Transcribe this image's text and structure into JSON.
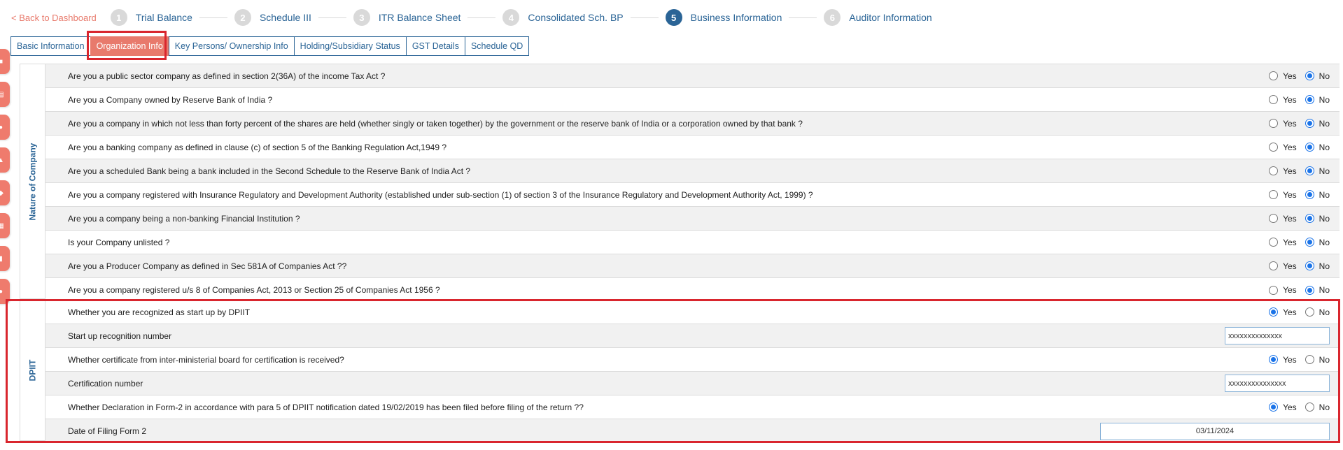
{
  "nav": {
    "back_label": "< Back to Dashboard",
    "steps": [
      {
        "num": "1",
        "label": "Trial Balance"
      },
      {
        "num": "2",
        "label": "Schedule III"
      },
      {
        "num": "3",
        "label": "ITR Balance Sheet"
      },
      {
        "num": "4",
        "label": "Consolidated Sch. BP"
      },
      {
        "num": "5",
        "label": "Business Information"
      },
      {
        "num": "6",
        "label": "Auditor Information"
      }
    ],
    "active_step": "5"
  },
  "tabs": [
    {
      "label": "Basic Information"
    },
    {
      "label": "Organization Info"
    },
    {
      "label": "Key Persons/ Ownership Info"
    },
    {
      "label": "Holding/Subsidiary Status"
    },
    {
      "label": "GST Details"
    },
    {
      "label": "Schedule QD"
    }
  ],
  "active_tab": "Organization Info",
  "radio_labels": {
    "yes": "Yes",
    "no": "No"
  },
  "nature": {
    "label": "Nature of Company",
    "questions": [
      {
        "text": "Are you a public sector company as defined in section 2(36A) of the income Tax Act ?",
        "answer": "No"
      },
      {
        "text": "Are you a Company owned by Reserve Bank of India ?",
        "answer": "No"
      },
      {
        "text": "Are you a company in which not less than forty percent of the shares are held (whether singly or taken together) by the government or the reserve bank of India or a corporation owned by that bank ?",
        "answer": "No"
      },
      {
        "text": "Are you a banking company as defined in clause (c) of section 5 of the Banking Regulation Act,1949 ?",
        "answer": "No"
      },
      {
        "text": "Are you a scheduled Bank being a bank included in the Second Schedule to the Reserve Bank of India Act ?",
        "answer": "No"
      },
      {
        "text": "Are you a company registered with Insurance Regulatory and Development Authority (established under sub-section (1) of section 3 of the Insurance Regulatory and Development Authority Act, 1999) ?",
        "answer": "No"
      },
      {
        "text": "Are you a company being a non-banking Financial Institution ?",
        "answer": "No"
      },
      {
        "text": "Is your Company unlisted ?",
        "answer": "No"
      },
      {
        "text": "Are you a Producer Company as defined in Sec 581A of Companies Act ??",
        "answer": "No"
      },
      {
        "text": "Are you a company registered u/s 8 of Companies Act, 2013 or Section 25 of Companies Act 1956 ?",
        "answer": "No"
      }
    ]
  },
  "dpiit": {
    "label": "DPIIT",
    "startup_question": "Whether you are recognized as start up by DPIIT",
    "startup_answer": "Yes",
    "recognition_label": "Start up recognition number",
    "recognition_value": "xxxxxxxxxxxxxx",
    "certificate_question": "Whether certificate from inter-ministerial board for certification is received?",
    "certificate_answer": "Yes",
    "certification_label": "Certification number",
    "certification_value": "xxxxxxxxxxxxxxx",
    "declaration_question": "Whether Declaration in Form-2 in accordance with para 5 of DPIIT notification dated 19/02/2019 has been filed before filing of the return ??",
    "declaration_answer": "Yes",
    "date_label": "Date of Filing Form 2",
    "date_value": "03/11/2024"
  },
  "colors": {
    "primary": "#2a6496",
    "accent": "#e87a6c",
    "highlight": "#d9262e",
    "radio_checked": "#1a73e8"
  }
}
